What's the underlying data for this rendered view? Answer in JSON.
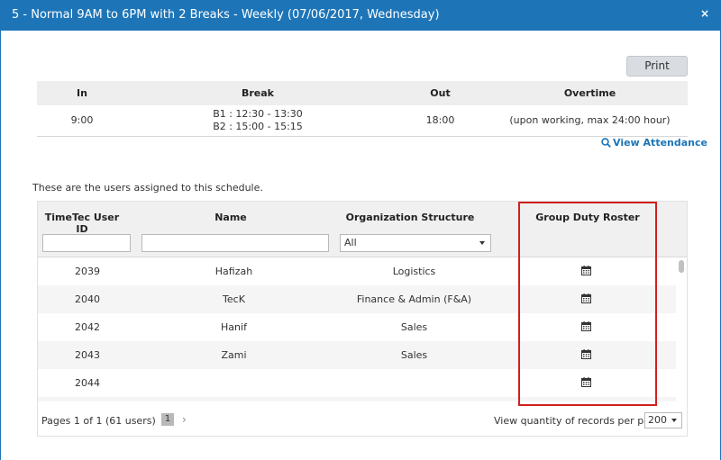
{
  "dialog": {
    "title": "5 - Normal 9AM to 6PM with 2 Breaks - Weekly (07/06/2017, Wednesday)",
    "close_label": "×"
  },
  "toolbar": {
    "print_label": "Print"
  },
  "schedule": {
    "headers": {
      "in": "In",
      "break": "Break",
      "out": "Out",
      "overtime": "Overtime"
    },
    "values": {
      "in": "9:00",
      "break_1": "B1 : 12:30 - 13:30",
      "break_2": "B2 : 15:00 - 15:15",
      "out": "18:00",
      "overtime": "(upon working, max 24:00 hour)"
    }
  },
  "view_attendance_label": "View Attendance",
  "intro_text": "These are the users assigned to this schedule.",
  "grid": {
    "headers": {
      "user_id": "TimeTec User ID",
      "name": "Name",
      "org": "Organization Structure",
      "gdr": "Group Duty Roster"
    },
    "filters": {
      "user_id": "",
      "name": "",
      "org": "All"
    },
    "rows": [
      {
        "id": "2039",
        "name": "Hafizah",
        "org": "Logistics"
      },
      {
        "id": "2040",
        "name": "TecK",
        "org": "Finance & Admin (F&A)"
      },
      {
        "id": "2042",
        "name": "Hanif",
        "org": "Sales"
      },
      {
        "id": "2043",
        "name": "Zami",
        "org": "Sales"
      },
      {
        "id": "2044",
        "name": "",
        "org": ""
      }
    ]
  },
  "pager": {
    "info": "Pages 1 of 1 (61 users)",
    "prev": "‹",
    "current_page": "1",
    "next": "›",
    "qty_label": "View quantity of records per page",
    "qty_value": "200"
  },
  "icons": {
    "calendar": "calendar-icon",
    "magnifier": "search-icon",
    "highlight_color": "#d21f1f",
    "brand_color": "#1d75b8"
  }
}
